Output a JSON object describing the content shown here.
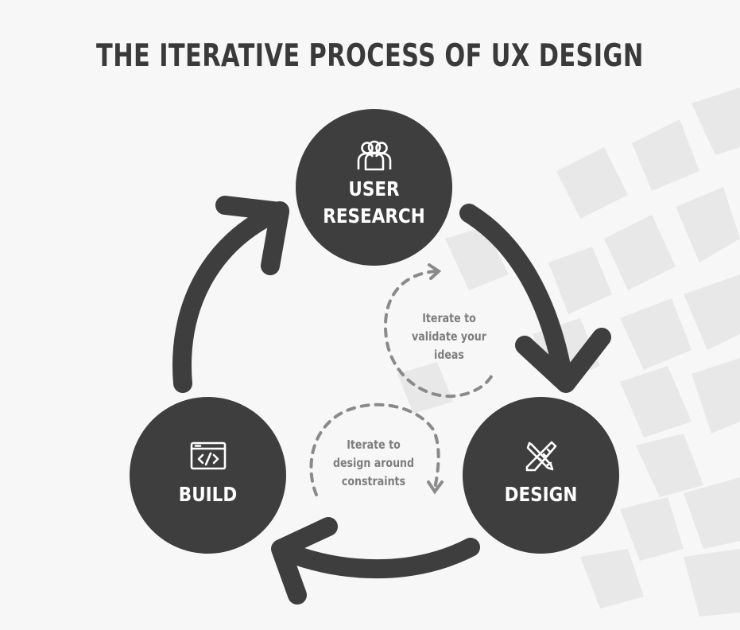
{
  "title": "THE ITERATIVE PROCESS OF UX DESIGN",
  "nodes": {
    "research": {
      "line1": "USER",
      "line2": "RESEARCH",
      "icon": "users-icon"
    },
    "build": {
      "label": "BUILD",
      "icon": "code-window-icon"
    },
    "design": {
      "label": "DESIGN",
      "icon": "pencil-ruler-icon"
    }
  },
  "notes": {
    "validate": {
      "line1": "Iterate to",
      "line2": "validate your",
      "line3": "ideas"
    },
    "constraints": {
      "line1": "Iterate to",
      "line2": "design around",
      "line3": "constraints"
    }
  },
  "colors": {
    "background": "#f7f7f7",
    "node_fill": "#3e3e3e",
    "arrow": "#3e3e3e",
    "dashed_arrow": "#8a8a8a",
    "title": "#3a3a3a",
    "note_text": "#7d7d7d",
    "decor": "#e7e7e7"
  }
}
